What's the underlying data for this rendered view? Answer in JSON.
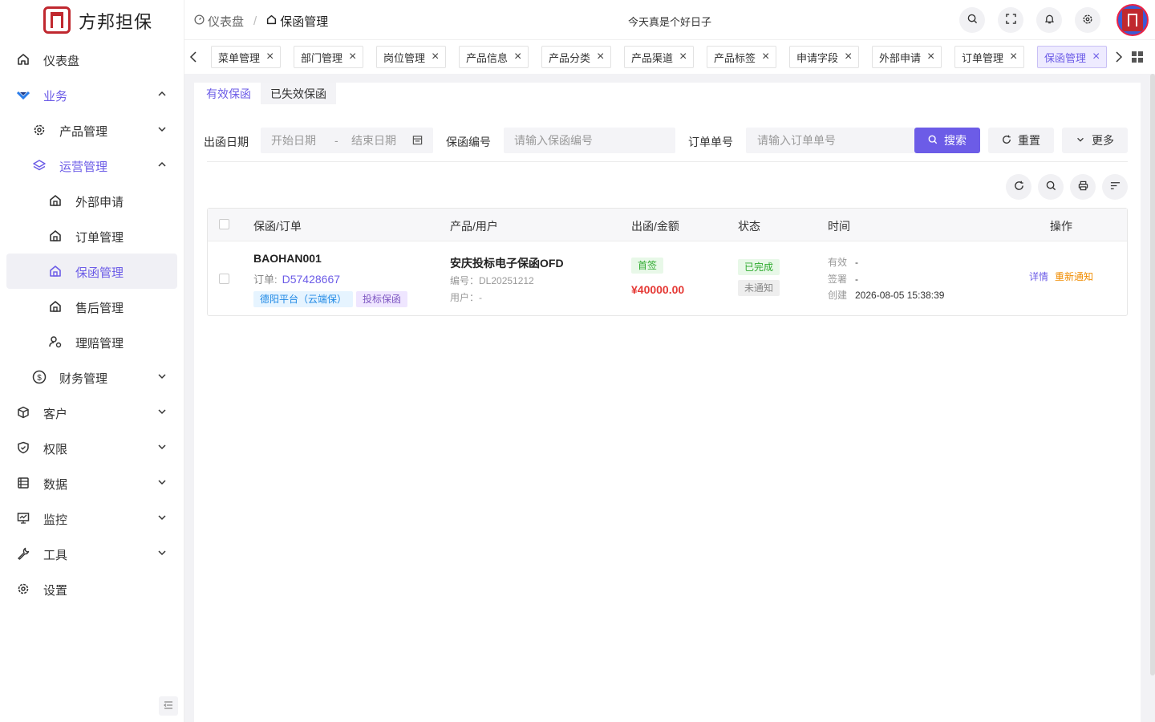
{
  "app": {
    "name": "方邦担保",
    "greeting": "今天真是个好日子"
  },
  "breadcrumb": {
    "home": "仪表盘",
    "current": "保函管理"
  },
  "sidebar": {
    "dashboard": "仪表盘",
    "business": "业务",
    "product_mgmt": "产品管理",
    "ops_mgmt": "运营管理",
    "external_apply": "外部申请",
    "order_mgmt": "订单管理",
    "guarantee_mgmt": "保函管理",
    "after_sales": "售后管理",
    "claims": "理赔管理",
    "finance": "财务管理",
    "customer": "客户",
    "permission": "权限",
    "data": "数据",
    "monitor": "监控",
    "tools": "工具",
    "settings": "设置"
  },
  "tabs": [
    {
      "label": "菜单管理"
    },
    {
      "label": "部门管理"
    },
    {
      "label": "岗位管理"
    },
    {
      "label": "产品信息"
    },
    {
      "label": "产品分类"
    },
    {
      "label": "产品渠道"
    },
    {
      "label": "产品标签"
    },
    {
      "label": "申请字段"
    },
    {
      "label": "外部申请"
    },
    {
      "label": "订单管理"
    },
    {
      "label": "保函管理"
    }
  ],
  "subtabs": {
    "valid": "有效保函",
    "expired": "已失效保函"
  },
  "filters": {
    "date_label": "出函日期",
    "start_placeholder": "开始日期",
    "range_sep": "-",
    "end_placeholder": "结束日期",
    "guarantee_no_label": "保函编号",
    "guarantee_no_placeholder": "请输入保函编号",
    "order_no_label": "订单单号",
    "order_no_placeholder": "请输入订单单号",
    "search": "搜索",
    "reset": "重置",
    "more": "更多"
  },
  "table": {
    "headers": {
      "guarantee": "保函/订单",
      "product": "产品/用户",
      "issue": "出函/金额",
      "status": "状态",
      "time": "时间",
      "action": "操作"
    },
    "rows": [
      {
        "guarantee_no": "BAOHAN001",
        "order_label": "订单:",
        "order_no": "D57428667",
        "tag1": "德阳平台（云端保）",
        "tag2": "投标保函",
        "product": "安庆投标电子保函OFD",
        "product_code": "编号：DL20251212",
        "user": "用户：-",
        "issue_type": "首签",
        "amount": "¥40000.00",
        "status1": "已完成",
        "status2": "未通知",
        "valid_label": "有效",
        "valid_value": "-",
        "sign_label": "签署",
        "sign_value": "-",
        "created_label": "创建",
        "created_value": "2026-08-05 15:38:39",
        "action_detail": "详情",
        "action_renotify": "重新通知"
      }
    ]
  }
}
